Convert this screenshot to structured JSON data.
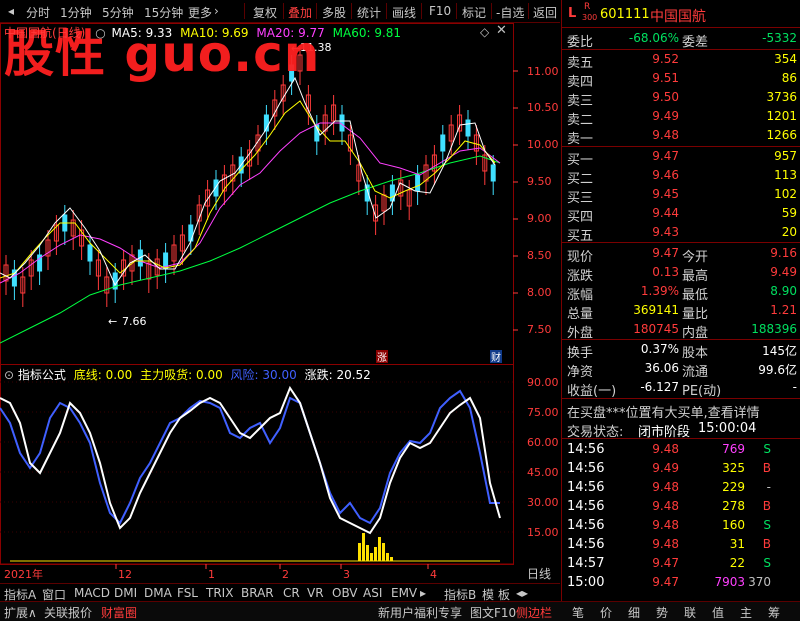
{
  "toolbar": {
    "items": [
      "分时",
      "1分钟",
      "5分钟",
      "15分钟",
      "更多",
      "复权",
      "叠加",
      "多股",
      "统计",
      "画线",
      "F10",
      "标记",
      "-自选",
      "返回"
    ]
  },
  "chart": {
    "title": "中国国航(日线)",
    "ma_labels": [
      "MA5: 9.33",
      "MA10: 9.69",
      "MA20: 9.77",
      "MA60: 9.81"
    ],
    "ma_colors": [
      "#ffffff",
      "#ffff00",
      "#ff40ff",
      "#00ff40"
    ],
    "high_label": "11.38",
    "low_label": "7.66",
    "y_ticks": [
      "11.00",
      "10.50",
      "10.00",
      "9.50",
      "9.00",
      "8.50",
      "8.00",
      "7.50"
    ],
    "badge_zhang": "涨",
    "badge_cai": "财",
    "watermark": "股性 guo.cn"
  },
  "indicator": {
    "name": "指标公式",
    "labels": [
      "底线: 0.00",
      "主力吸货: 0.00",
      "风险: 30.00",
      "涨跌: 20.52"
    ],
    "y_ticks": [
      "90.00",
      "75.00",
      "60.00",
      "45.00",
      "30.00",
      "15.00"
    ]
  },
  "date_axis": {
    "labels": [
      "2021年",
      "12",
      "1",
      "2",
      "3",
      "4"
    ],
    "period": "日线"
  },
  "index_tabs": [
    "指标A",
    "窗口",
    "MACD",
    "DMI",
    "DMA",
    "FSL",
    "TRIX",
    "BRAR",
    "CR",
    "VR",
    "OBV",
    "ASI",
    "EMV",
    "指标B",
    "模",
    "板"
  ],
  "bottom_bar": {
    "left": [
      "扩展∧",
      "关联报价",
      "财富圈"
    ],
    "news": "新用户福利专享",
    "right": [
      "图文F10",
      "侧边栏",
      "笔",
      "价",
      "细",
      "势",
      "联",
      "值",
      "主",
      "筹"
    ]
  },
  "quote": {
    "code": "601111",
    "name": "中国国航",
    "r_badge": "R",
    "l_badge": "L",
    "sub": "300",
    "weibi_label": "委比",
    "weibi": "-68.06%",
    "weicha_label": "委差",
    "weicha": "-5332",
    "asks": [
      {
        "label": "卖五",
        "price": "9.52",
        "vol": "354"
      },
      {
        "label": "卖四",
        "price": "9.51",
        "vol": "86"
      },
      {
        "label": "卖三",
        "price": "9.50",
        "vol": "3736"
      },
      {
        "label": "卖二",
        "price": "9.49",
        "vol": "1201"
      },
      {
        "label": "卖一",
        "price": "9.48",
        "vol": "1266"
      }
    ],
    "bids": [
      {
        "label": "买一",
        "price": "9.47",
        "vol": "957"
      },
      {
        "label": "买二",
        "price": "9.46",
        "vol": "113"
      },
      {
        "label": "买三",
        "price": "9.45",
        "vol": "102"
      },
      {
        "label": "买四",
        "price": "9.44",
        "vol": "59"
      },
      {
        "label": "买五",
        "price": "9.43",
        "vol": "20"
      }
    ],
    "stats": [
      {
        "l1": "现价",
        "v1": "9.47",
        "c1": "red",
        "l2": "今开",
        "v2": "9.16",
        "c2": "red"
      },
      {
        "l1": "涨跌",
        "v1": "0.13",
        "c1": "red",
        "l2": "最高",
        "v2": "9.49",
        "c2": "red"
      },
      {
        "l1": "涨幅",
        "v1": "1.39%",
        "c1": "red",
        "l2": "最低",
        "v2": "8.90",
        "c2": "green"
      },
      {
        "l1": "总量",
        "v1": "369141",
        "c1": "yellow",
        "l2": "量比",
        "v2": "1.21",
        "c2": "red"
      },
      {
        "l1": "外盘",
        "v1": "180745",
        "c1": "red",
        "l2": "内盘",
        "v2": "188396",
        "c2": "green"
      }
    ],
    "stats2": [
      {
        "l1": "换手",
        "v1": "0.37%",
        "l2": "股本",
        "v2": "145亿"
      },
      {
        "l1": "净资",
        "v1": "36.06",
        "l2": "流通",
        "v2": "99.6亿"
      },
      {
        "l1": "收益(一)",
        "v1": "-6.127",
        "l2": "PE(动)",
        "v2": "-"
      }
    ],
    "notice": "在买盘***位置有大买单,查看详情",
    "status_label": "交易状态:",
    "status": "闭市阶段",
    "status_time": "15:00:04",
    "ticks": [
      {
        "t": "14:56",
        "p": "9.48",
        "v": "769",
        "vc": "#ff40ff",
        "s": "S",
        "sc": "#00e060"
      },
      {
        "t": "14:56",
        "p": "9.49",
        "v": "325",
        "vc": "#ffff00",
        "s": "B",
        "sc": "#ff3b3b"
      },
      {
        "t": "14:56",
        "p": "9.48",
        "v": "229",
        "vc": "#ffff00",
        "s": "-",
        "sc": "#c0c0c0"
      },
      {
        "t": "14:56",
        "p": "9.48",
        "v": "278",
        "vc": "#ffff00",
        "s": "B",
        "sc": "#ff3b3b"
      },
      {
        "t": "14:56",
        "p": "9.48",
        "v": "160",
        "vc": "#ffff00",
        "s": "S",
        "sc": "#00e060"
      },
      {
        "t": "14:56",
        "p": "9.48",
        "v": "31",
        "vc": "#ffff00",
        "s": "B",
        "sc": "#ff3b3b"
      },
      {
        "t": "14:57",
        "p": "9.47",
        "v": "22",
        "vc": "#ffff00",
        "s": "S",
        "sc": "#00e060"
      },
      {
        "t": "15:00",
        "p": "9.47",
        "v": "7903",
        "vc": "#ff40ff",
        "s": "370",
        "sc": "#c0c0c0"
      }
    ]
  }
}
